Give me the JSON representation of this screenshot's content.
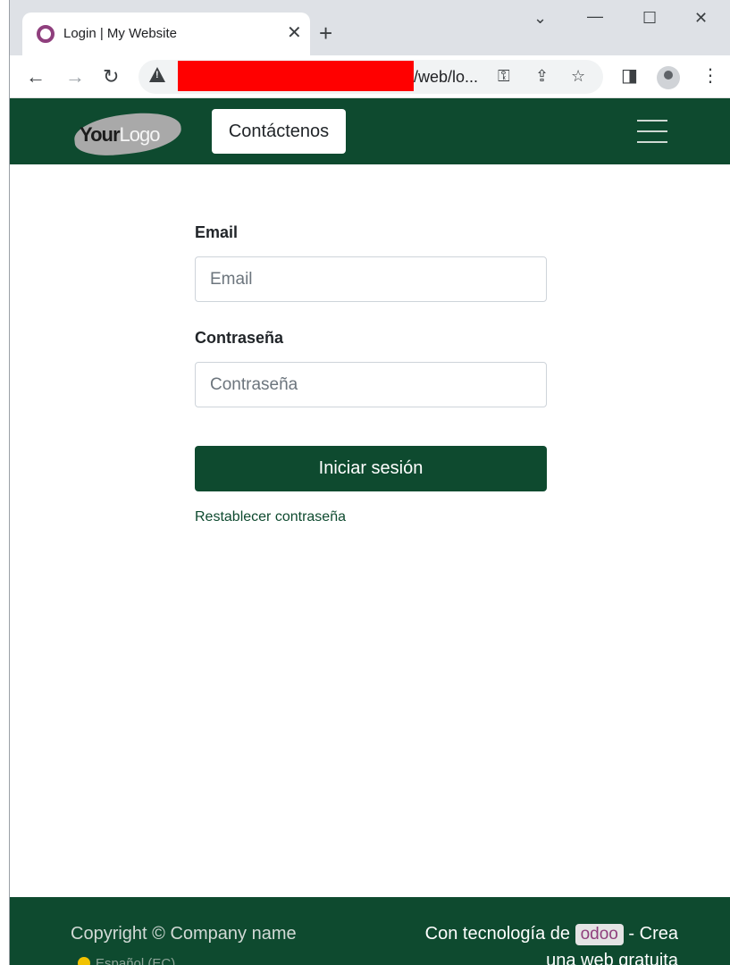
{
  "browser": {
    "tab_title": "Login | My Website",
    "url_visible": "/web/lo...",
    "icons": [
      "tab-favicon",
      "close-icon",
      "plus-icon",
      "chevron-down-icon",
      "minimize-icon",
      "maximize-icon",
      "close-window-icon",
      "back-icon",
      "forward-icon",
      "reload-icon",
      "warning-icon",
      "key-icon",
      "share-icon",
      "star-icon",
      "sidepanel-icon",
      "profile-icon",
      "kebab-menu-icon"
    ]
  },
  "header": {
    "logo_bold": "Your",
    "logo_light": "Logo",
    "contact_label": "Contáctenos"
  },
  "form": {
    "email_label": "Email",
    "email_placeholder": "Email",
    "password_label": "Contraseña",
    "password_placeholder": "Contraseña",
    "submit_label": "Iniciar sesión",
    "reset_link": "Restablecer contraseña"
  },
  "footer": {
    "copyright": "Copyright © Company name",
    "language": "Español (EC)",
    "powered_prefix": "Con tecnología de",
    "odoo_label": "odoo",
    "powered_suffix": "- Crea una web gratuita"
  },
  "colors": {
    "brand_green": "#0e4a2f",
    "odoo_purple": "#8f3f7d"
  }
}
